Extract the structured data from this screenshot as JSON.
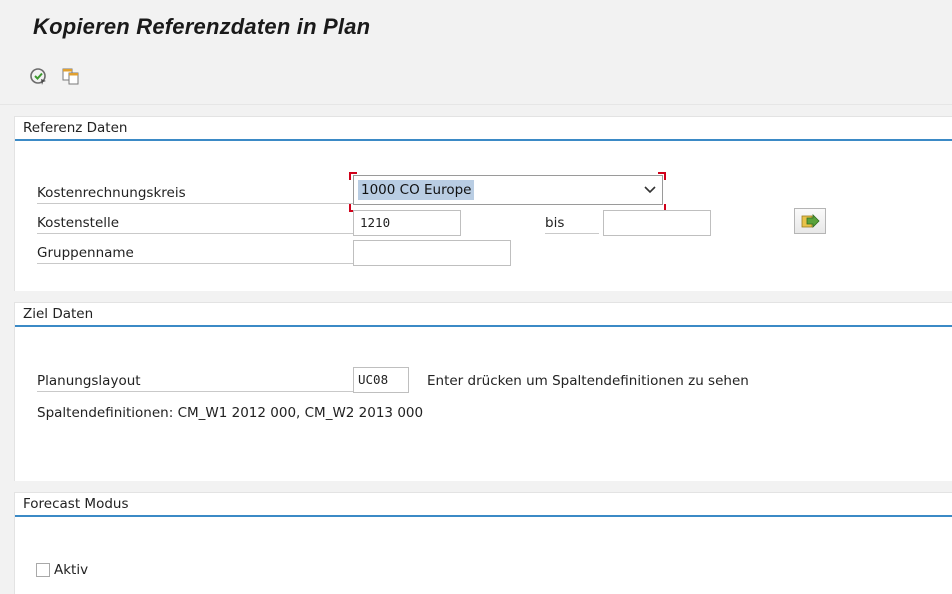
{
  "window": {
    "title": "Kopieren Referenzdaten in Plan"
  },
  "toolbar": {
    "buttons": [
      {
        "name": "execute-icon",
        "tooltip": ""
      },
      {
        "name": "copy-icon",
        "tooltip": ""
      }
    ]
  },
  "referenz": {
    "title": "Referenz Daten",
    "kostenrechnungskreis_label": "Kostenrechnungskreis",
    "kostenrechnungskreis_value": "1000 CO Europe",
    "kostenstelle_label": "Kostenstelle",
    "kostenstelle_value": "1210",
    "bis_label": "bis",
    "bis_value": "",
    "gruppenname_label": "Gruppenname",
    "gruppenname_value": ""
  },
  "ziel": {
    "title": "Ziel Daten",
    "planungslayout_label": "Planungslayout",
    "planungslayout_value": "UC08",
    "hint": "Enter drücken um Spaltendefinitionen zu sehen",
    "spalten": "Spaltendefinitionen: CM_W1 2012 000, CM_W2 2013 000"
  },
  "forecast": {
    "title": "Forecast Modus",
    "aktiv_label": "Aktiv",
    "aktiv_checked": false
  },
  "colors": {
    "accent_line": "#3b8ac6",
    "selection": "#b9cde3",
    "focus_corner": "#d0021b"
  }
}
